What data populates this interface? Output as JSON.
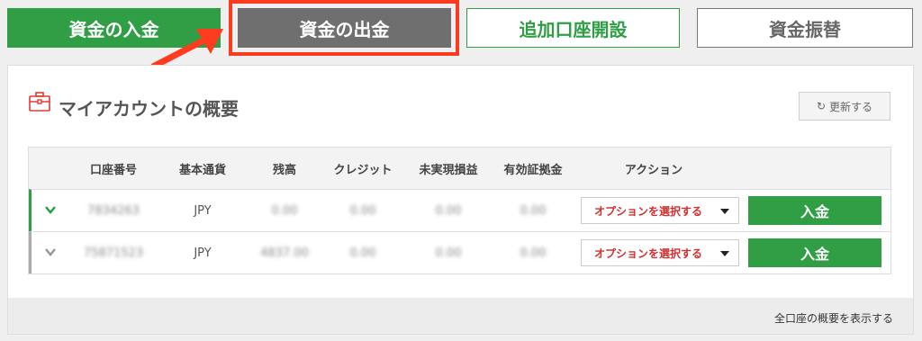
{
  "top_buttons": {
    "deposit": "資金の入金",
    "withdraw": "資金の出金",
    "open_account": "追加口座開設",
    "transfer": "資金振替"
  },
  "panel": {
    "title": "マイアカウントの概要",
    "refresh_label": "更新する",
    "icon": "briefcase-icon"
  },
  "table": {
    "headers": [
      "口座番号",
      "基本通貨",
      "残高",
      "クレジット",
      "未実現損益",
      "有効証拠金",
      "アクション"
    ],
    "rows": [
      {
        "account": "7834263",
        "currency": "JPY",
        "balance": "0.00",
        "credit": "0.00",
        "unrealized": "0.00",
        "equity": "0.00",
        "action_select": "オプションを選択する",
        "deposit_label": "入金"
      },
      {
        "account": "75871523",
        "currency": "JPY",
        "balance": "4837.00",
        "credit": "0.00",
        "unrealized": "0.00",
        "equity": "0.00",
        "action_select": "オプションを選択する",
        "deposit_label": "入金"
      }
    ]
  },
  "footer": {
    "link": "全口座の概要を表示する"
  },
  "colors": {
    "green": "#2f9e44",
    "red_highlight": "#ff3b1f",
    "gray_button": "#6f6f6f",
    "select_text": "#d32f2f"
  }
}
